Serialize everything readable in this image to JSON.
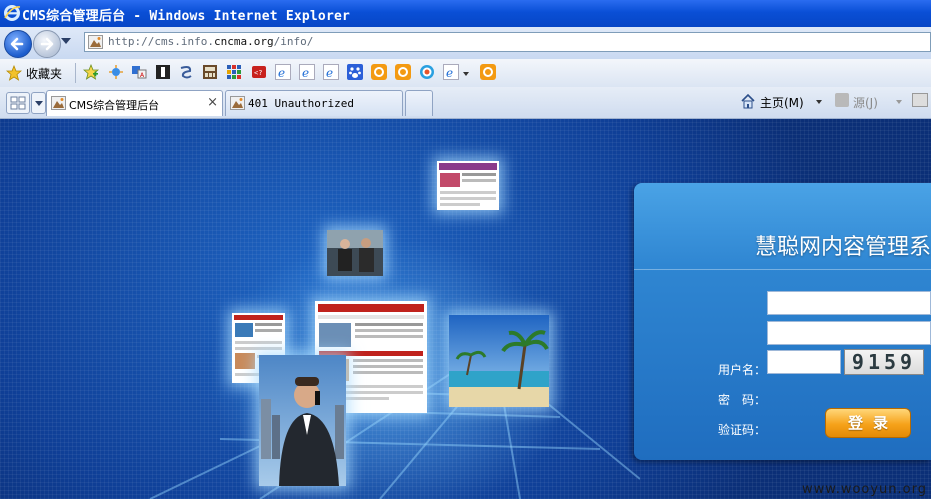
{
  "window": {
    "title": "CMS综合管理后台 - Windows Internet Explorer"
  },
  "address_bar": {
    "url_prefix": "http://cms.info.",
    "url_domain": "cncma.org",
    "url_suffix": "/info/"
  },
  "favorites_bar": {
    "label": "收藏夹",
    "icons": [
      "add-favorite-icon",
      "sun-shortcut-icon",
      "translate-icon",
      "shortcut-icon",
      "swirl-icon",
      "calculator-icon",
      "grid-icon",
      "red-tag-icon",
      "ie-link-icon",
      "ie-link-icon",
      "ie-link-icon",
      "baidu-paw-icon",
      "orange-link-icon",
      "orange-link-icon",
      "orange-target-icon",
      "ie-link-icon",
      "orange-link-icon"
    ]
  },
  "tabs": [
    {
      "label": "CMS综合管理后台",
      "active": true,
      "close": "×"
    },
    {
      "label": "401 Unauthorized",
      "active": false
    }
  ],
  "command_bar": {
    "home_label": "主页(M)",
    "feeds_label": "源(J)"
  },
  "login": {
    "title": "慧聪网内容管理系",
    "username_label": "用户名：",
    "password_label": "密　码：",
    "captcha_label": "验证码：",
    "captcha_value": "9159",
    "username_value": "",
    "password_value": "",
    "captcha_input_value": "",
    "submit_label": "登录"
  },
  "watermark": "www.wooyun.org",
  "colors": {
    "titlebar": "#0a4fd6",
    "content_bg": "#1a56b3",
    "panel": "#2f86d2",
    "login_button": "#f6a21a"
  }
}
